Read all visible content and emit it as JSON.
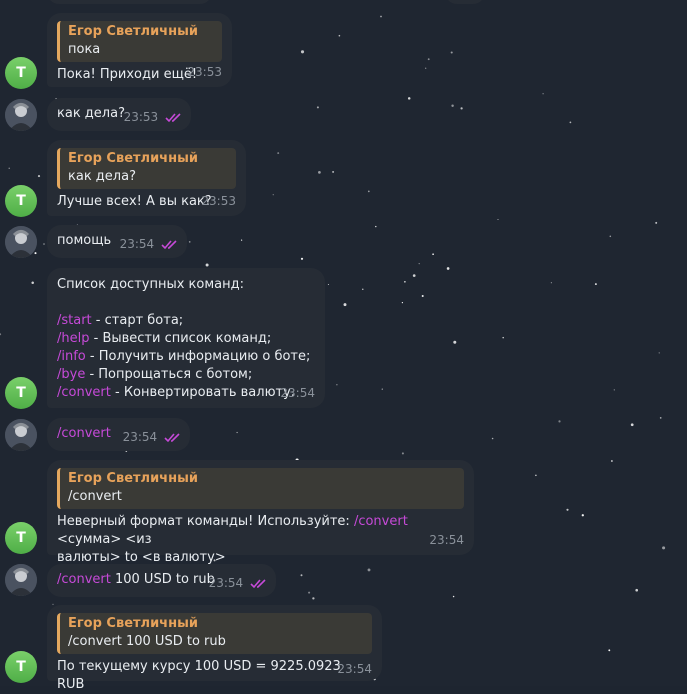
{
  "bot_name": "Егор Светличный",
  "avatar_letter": "T",
  "messages": [
    {
      "reply_text": "пока",
      "text": "Пока! Приходи ещё!",
      "time": "23:53"
    },
    {
      "text": "как дела?",
      "time": "23:53"
    },
    {
      "reply_text": "как дела?",
      "text": "Лучше всех! А вы как?",
      "time": "23:53"
    },
    {
      "text": "помощь",
      "time": "23:54"
    },
    {
      "title": "Список доступных команд:",
      "commands": [
        {
          "cmd": "/start",
          "desc": " - старт бота;"
        },
        {
          "cmd": "/help",
          "desc": " - Вывести список команд;"
        },
        {
          "cmd": "/info",
          "desc": " - Получить информацию о боте;"
        },
        {
          "cmd": "/bye",
          "desc": " - Попрощаться с ботом;"
        },
        {
          "cmd": "/convert",
          "desc": " - Конвертировать валюту."
        }
      ],
      "time": "23:54"
    },
    {
      "cmd": "/convert",
      "time": "23:54"
    },
    {
      "reply_text": "/convert",
      "text_before": "Неверный формат команды! Используйте: ",
      "cmd": "/convert",
      "text_after": " <сумма> <из",
      "text_line2": "валюты> to <в валюту>",
      "time": "23:54"
    },
    {
      "cmd": "/convert",
      "text": " 100 USD to rub",
      "time": "23:54"
    },
    {
      "reply_text": "/convert 100 USD to rub",
      "text": "По текущему курсу 100 USD = 9225.0923 RUB",
      "time": "23:54"
    }
  ],
  "colors": {
    "command": "#c64ad8",
    "reply_name": "#e7a25a",
    "read_ticks": "#c64ad8"
  }
}
